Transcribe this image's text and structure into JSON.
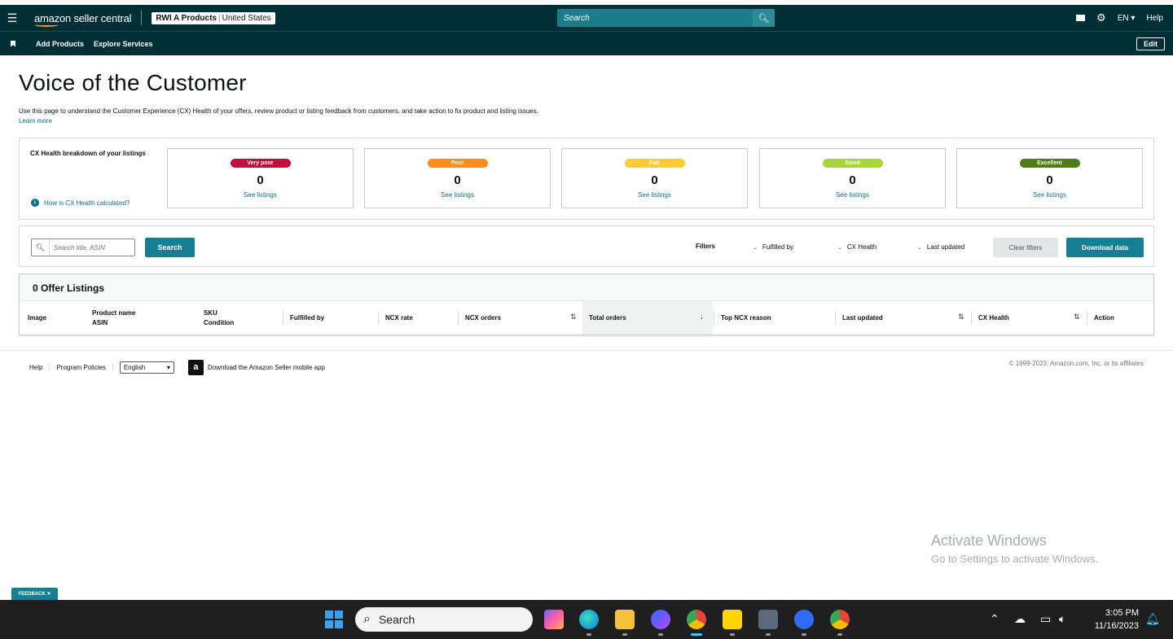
{
  "nav": {
    "logo_text": "amazon seller central",
    "account_name": "RWI A Products",
    "account_region": "United States",
    "search_placeholder": "Search",
    "lang": "EN",
    "help": "Help"
  },
  "subnav": {
    "links": [
      "Add Products",
      "Explore Services"
    ],
    "edit": "Edit"
  },
  "page": {
    "title": "Voice of the Customer",
    "description": "Use this page to understand the Customer Experience (CX) Health of your offers, review product or listing feedback from customers, and take action to fix product and listing issues.",
    "learn_more": "Learn more"
  },
  "cx_health": {
    "label": "CX Health breakdown of your listings",
    "info_link": "How is CX Health calculated?",
    "tiles": [
      {
        "label": "Very poor",
        "count": "0",
        "link": "See listings",
        "color": "#c40d3c"
      },
      {
        "label": "Poor",
        "count": "0",
        "link": "See listings",
        "color": "#ff8c1a"
      },
      {
        "label": "Fair",
        "count": "0",
        "link": "See listings",
        "color": "#ffcc33"
      },
      {
        "label": "Good",
        "count": "0",
        "link": "See listings",
        "color": "#a8d63a"
      },
      {
        "label": "Excellent",
        "count": "0",
        "link": "See listings",
        "color": "#4e7d16"
      }
    ]
  },
  "filters": {
    "search_placeholder": "Search title, ASIN",
    "search_button": "Search",
    "label": "Filters",
    "dropdowns": [
      "Fulfilled by",
      "CX Health",
      "Last updated"
    ],
    "clear": "Clear filters",
    "download": "Download data"
  },
  "table": {
    "title": "0 Offer Listings",
    "columns": {
      "image": "Image",
      "product_name": "Product name",
      "asin": "ASIN",
      "sku": "SKU",
      "condition": "Condition",
      "fulfilled_by": "Fulfilled by",
      "ncx_rate": "NCX rate",
      "ncx_orders": "NCX orders",
      "total_orders": "Total orders",
      "top_ncx_reason": "Top NCX reason",
      "last_updated": "Last updated",
      "cx_health": "CX Health",
      "action": "Action"
    }
  },
  "footer": {
    "links": [
      "Help",
      "Program Policies"
    ],
    "language": "English",
    "app_text": "Download the Amazon Seller mobile app",
    "copyright": "© 1999-2023, Amazon.com, Inc. or its affiliates"
  },
  "watermark": {
    "line1": "Activate Windows",
    "line2": "Go to Settings to activate Windows."
  },
  "feedback": "FEEDBACK ✕",
  "taskbar": {
    "search": "Search",
    "time": "3:05 PM",
    "date": "11/16/2023"
  }
}
